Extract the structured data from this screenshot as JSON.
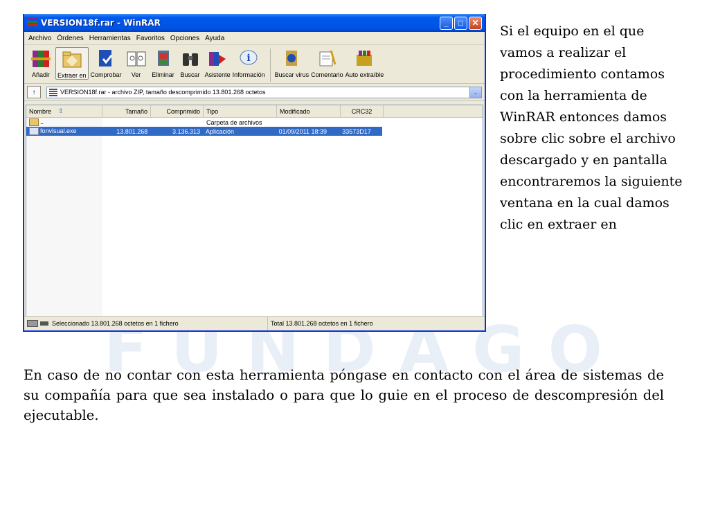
{
  "window": {
    "title": "VERSION18f.rar - WinRAR",
    "controls": {
      "minimize": "_",
      "maximize": "□",
      "close": "✕"
    }
  },
  "menu": [
    "Archivo",
    "Órdenes",
    "Herramientas",
    "Favoritos",
    "Opciones",
    "Ayuda"
  ],
  "toolbar": [
    {
      "label": "Añadir",
      "icon": "books-add-icon"
    },
    {
      "label": "Extraer en",
      "icon": "extract-folder-icon"
    },
    {
      "label": "Comprobar",
      "icon": "test-archive-icon"
    },
    {
      "label": "Ver",
      "icon": "view-book-icon"
    },
    {
      "label": "Eliminar",
      "icon": "delete-icon"
    },
    {
      "label": "Buscar",
      "icon": "binoculars-icon"
    },
    {
      "label": "Asistente",
      "icon": "wizard-icon"
    },
    {
      "label": "Información",
      "icon": "info-icon"
    },
    {
      "label": "Buscar virus",
      "icon": "virus-scan-icon"
    },
    {
      "label": "Comentario",
      "icon": "comment-icon"
    },
    {
      "label": "Auto extraíble",
      "icon": "sfx-icon"
    }
  ],
  "address": {
    "up_label": "↑",
    "path": "VERSION18f.rar - archivo ZIP, tamaño descomprimido 13.801.268 octetos",
    "dropdown": "⌄"
  },
  "columns": {
    "name": "Nombre",
    "size": "Tamaño",
    "compressed": "Comprimido",
    "type": "Tipo",
    "modified": "Modificado",
    "crc": "CRC32"
  },
  "files": [
    {
      "name": "..",
      "size": "",
      "compressed": "",
      "type": "Carpeta de archivos",
      "modified": "",
      "crc": ""
    },
    {
      "name": "fonvisual.exe",
      "size": "13.801.268",
      "compressed": "3.136.313",
      "type": "Aplicación",
      "modified": "01/09/2011 18:39",
      "crc": "33573D17"
    }
  ],
  "status": {
    "left": "Seleccionado 13.801.268 octetos en 1 fichero",
    "right": "Total 13.801.268 octetos en 1 fichero"
  },
  "side_text": "Si el equipo en el que vamos a realizar el procedimiento contamos con la herramienta de WinRAR entonces damos sobre clic sobre el archivo descargado y en pantalla encontraremos la siguiente ventana en la cual damos clic en extraer en",
  "bottom_text": "En caso de no contar con esta herramienta póngase en contacto con el área de sistemas de su compañía para que sea instalado o para que lo guie en el proceso de descompresión del ejecutable.",
  "watermark": "FUNDAGO",
  "colors": {
    "title_blue": "#0054e3",
    "selection": "#316ac5",
    "window_bg": "#ece9d8"
  }
}
